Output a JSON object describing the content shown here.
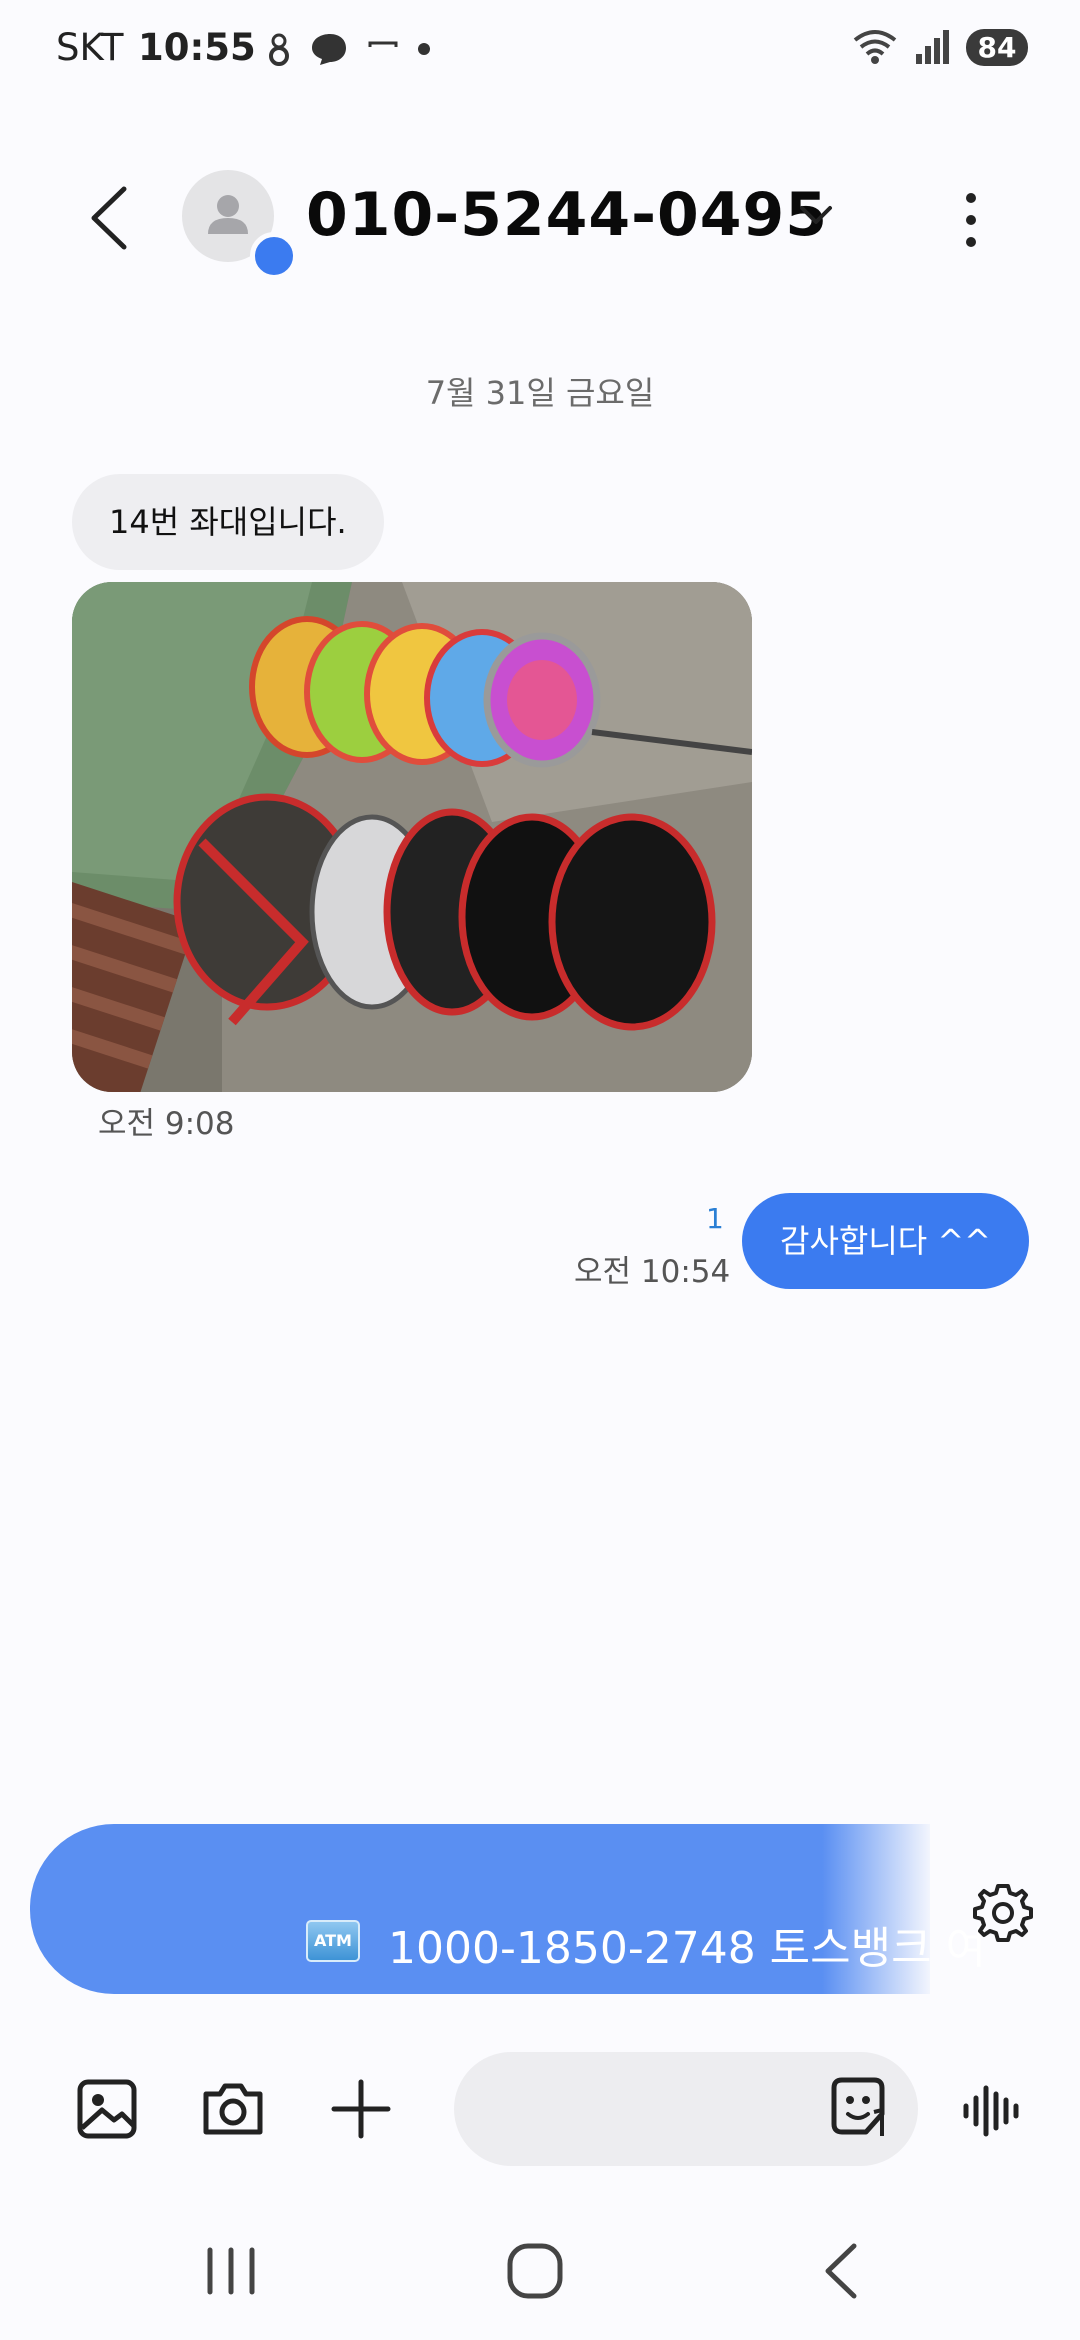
{
  "status_bar": {
    "carrier": "SKT",
    "time": "10:55",
    "battery": "84"
  },
  "header": {
    "contact_name": "010-5244-0495"
  },
  "conversation": {
    "date_separator": "7월 31일 금요일",
    "incoming": {
      "text": "14번 좌대입니다.",
      "time": "오전 9:08"
    },
    "outgoing": {
      "text": "감사합니다 ^^",
      "time": "오전 10:54",
      "unread_count": "1"
    }
  },
  "suggestion": {
    "icon": "atm-icon",
    "text": "1000-1850-2748 토스뱅크 여"
  },
  "input": {
    "placeholder": ""
  },
  "colors": {
    "accent": "#3b7bf0",
    "suggestion_bg": "#5a8ff2",
    "incoming_bubble": "#eeeef1",
    "background": "#fbfbfe"
  }
}
